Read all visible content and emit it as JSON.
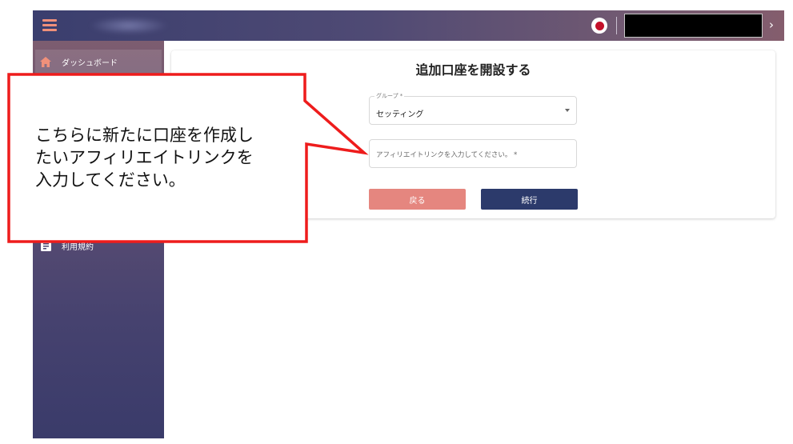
{
  "header": {
    "language_flag": "japan-flag-icon",
    "account_display": "",
    "menu_icon": "hamburger-menu-icon",
    "expand_icon": "chevron-right-icon"
  },
  "sidebar": {
    "items": [
      {
        "label": "ダッシュボード",
        "icon": "home-icon",
        "active": true
      },
      {
        "label": "利用規約",
        "icon": "document-icon",
        "active": false
      }
    ]
  },
  "form": {
    "title": "追加口座を開設する",
    "group_field": {
      "label": "グループ *",
      "value": "セッティング"
    },
    "affiliate_field": {
      "placeholder": "アフィリエイトリンクを入力してください。 *",
      "value": ""
    },
    "back_label": "戻る",
    "next_label": "続行"
  },
  "annotation": {
    "lines": [
      "こちらに新たに口座を作成し",
      "たいアフィリエイトリンクを",
      "入力してください。"
    ]
  },
  "colors": {
    "accent": "#e5867f",
    "primary": "#2c3a6b",
    "callout_border": "#ee1c1c"
  }
}
